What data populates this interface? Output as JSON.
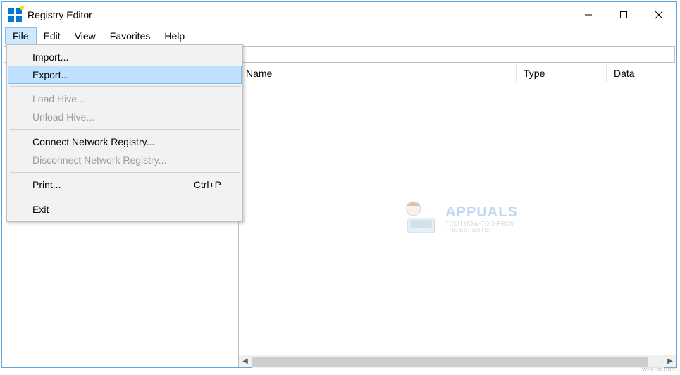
{
  "window": {
    "title": "Registry Editor"
  },
  "menubar": {
    "items": [
      {
        "label": "File",
        "open": true
      },
      {
        "label": "Edit"
      },
      {
        "label": "View"
      },
      {
        "label": "Favorites"
      },
      {
        "label": "Help"
      }
    ]
  },
  "file_menu": {
    "items": [
      {
        "label": "Import...",
        "enabled": true
      },
      {
        "label": "Export...",
        "enabled": true,
        "highlight": true
      },
      {
        "sep": true
      },
      {
        "label": "Load Hive...",
        "enabled": false
      },
      {
        "label": "Unload Hive...",
        "enabled": false
      },
      {
        "sep": true
      },
      {
        "label": "Connect Network Registry...",
        "enabled": true
      },
      {
        "label": "Disconnect Network Registry...",
        "enabled": false
      },
      {
        "sep": true
      },
      {
        "label": "Print...",
        "enabled": true,
        "shortcut": "Ctrl+P"
      },
      {
        "sep": true
      },
      {
        "label": "Exit",
        "enabled": true
      }
    ]
  },
  "list_columns": {
    "name": "Name",
    "type": "Type",
    "data": "Data"
  },
  "watermark": {
    "title": "APPUALS",
    "sub1": "TECH HOW-TO'S FROM",
    "sub2": "THE EXPERTS!"
  },
  "credit": "wsxdn.com",
  "addressbar_value": ""
}
